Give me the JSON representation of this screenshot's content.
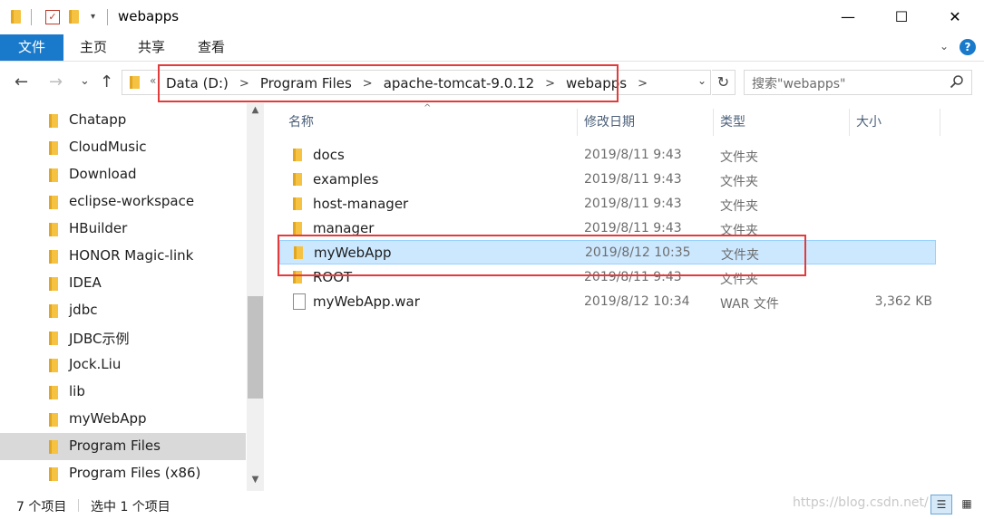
{
  "window": {
    "title": "webapps",
    "minimize": "—",
    "maximize": "☐",
    "close": "✕"
  },
  "ribbon": {
    "tabs": [
      "文件",
      "主页",
      "共享",
      "查看"
    ],
    "expand": "⌄",
    "help": "?"
  },
  "address": {
    "overflow": "«",
    "crumbs": [
      "Data (D:)",
      "Program Files",
      "apache-tomcat-9.0.12",
      "webapps"
    ],
    "crumb_sep": ">",
    "dropdown": "⌄",
    "refresh": "↻"
  },
  "search": {
    "placeholder": "搜索\"webapps\"",
    "icon": "search-icon"
  },
  "navigation": {
    "back": "←",
    "forward": "→",
    "recent": "⌄",
    "up": "↑",
    "items": [
      {
        "label": "Chatapp",
        "selected": false
      },
      {
        "label": "CloudMusic",
        "selected": false
      },
      {
        "label": "Download",
        "selected": false
      },
      {
        "label": "eclipse-workspace",
        "selected": false
      },
      {
        "label": "HBuilder",
        "selected": false
      },
      {
        "label": "HONOR Magic-link",
        "selected": false
      },
      {
        "label": "IDEA",
        "selected": false
      },
      {
        "label": "jdbc",
        "selected": false
      },
      {
        "label": "JDBC示例",
        "selected": false
      },
      {
        "label": "Jock.Liu",
        "selected": false
      },
      {
        "label": "lib",
        "selected": false
      },
      {
        "label": "myWebApp",
        "selected": false
      },
      {
        "label": "Program Files",
        "selected": true
      },
      {
        "label": "Program Files (x86)",
        "selected": false
      }
    ]
  },
  "columns": {
    "name": "名称",
    "date": "修改日期",
    "type": "类型",
    "size": "大小"
  },
  "files": [
    {
      "name": "docs",
      "date": "2019/8/11 9:43",
      "type": "文件夹",
      "size": "",
      "kind": "folder",
      "selected": false
    },
    {
      "name": "examples",
      "date": "2019/8/11 9:43",
      "type": "文件夹",
      "size": "",
      "kind": "folder",
      "selected": false
    },
    {
      "name": "host-manager",
      "date": "2019/8/11 9:43",
      "type": "文件夹",
      "size": "",
      "kind": "folder",
      "selected": false
    },
    {
      "name": "manager",
      "date": "2019/8/11 9:43",
      "type": "文件夹",
      "size": "",
      "kind": "folder",
      "selected": false
    },
    {
      "name": "myWebApp",
      "date": "2019/8/12 10:35",
      "type": "文件夹",
      "size": "",
      "kind": "folder",
      "selected": true
    },
    {
      "name": "ROOT",
      "date": "2019/8/11 9:43",
      "type": "文件夹",
      "size": "",
      "kind": "folder",
      "selected": false
    },
    {
      "name": "myWebApp.war",
      "date": "2019/8/12 10:34",
      "type": "WAR 文件",
      "size": "3,362 KB",
      "kind": "file",
      "selected": false
    }
  ],
  "status": {
    "item_count": "7 个项目",
    "selected": "选中 1 个项目",
    "watermark": "https://blog.csdn.net/"
  },
  "colors": {
    "accent": "#1979ca",
    "selection": "#cce8ff",
    "highlight_box": "#e23b3b",
    "folder": "#f5c242"
  }
}
